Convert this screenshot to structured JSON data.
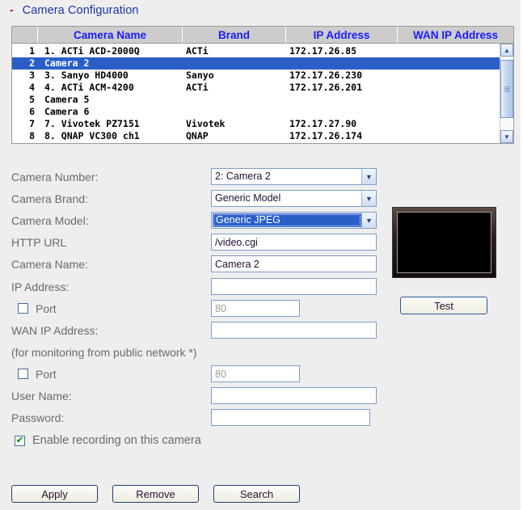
{
  "page": {
    "title": "Camera Configuration",
    "collapse_glyph": "-"
  },
  "camera_table": {
    "columns": [
      "",
      "Camera Name",
      "Brand",
      "IP Address",
      "WAN IP Address"
    ],
    "rows": [
      {
        "num": "1",
        "name": "1. ACTi ACD-2000Q",
        "brand": "ACTi",
        "ip": "172.17.26.85",
        "wan": "",
        "selected": false
      },
      {
        "num": "2",
        "name": "Camera 2",
        "brand": "",
        "ip": "",
        "wan": "",
        "selected": true
      },
      {
        "num": "3",
        "name": "3. Sanyo HD4000",
        "brand": "Sanyo",
        "ip": "172.17.26.230",
        "wan": "",
        "selected": false
      },
      {
        "num": "4",
        "name": "4. ACTi ACM-4200",
        "brand": "ACTi",
        "ip": "172.17.26.201",
        "wan": "",
        "selected": false
      },
      {
        "num": "5",
        "name": "Camera 5",
        "brand": "",
        "ip": "",
        "wan": "",
        "selected": false
      },
      {
        "num": "6",
        "name": "Camera 6",
        "brand": "",
        "ip": "",
        "wan": "",
        "selected": false
      },
      {
        "num": "7",
        "name": "7. Vivotek PZ7151",
        "brand": "Vivotek",
        "ip": "172.17.27.90",
        "wan": "",
        "selected": false
      },
      {
        "num": "8",
        "name": "8. QNAP VC300 ch1",
        "brand": "QNAP",
        "ip": "172.17.26.174",
        "wan": "",
        "selected": false
      }
    ],
    "scroll_up_glyph": "▲",
    "scroll_down_glyph": "▼"
  },
  "form": {
    "camera_number": {
      "label": "Camera Number:",
      "value": "2: Camera 2"
    },
    "camera_brand": {
      "label": "Camera Brand:",
      "value": "Generic Model"
    },
    "camera_model": {
      "label": "Camera Model:",
      "value": "Generic JPEG"
    },
    "http_url": {
      "label": "HTTP URL",
      "value": "/video.cgi"
    },
    "camera_name": {
      "label": "Camera Name:",
      "value": "Camera 2"
    },
    "ip_address": {
      "label": "IP Address:",
      "value": ""
    },
    "lan_port": {
      "label": "Port",
      "value": "80",
      "checked": false
    },
    "wan_ip": {
      "label": "WAN IP Address:",
      "value": ""
    },
    "wan_note": "(for monitoring from public network *)",
    "wan_port": {
      "label": "Port",
      "value": "80",
      "checked": false
    },
    "user_name": {
      "label": "User Name:",
      "value": ""
    },
    "password": {
      "label": "Password:",
      "value": ""
    },
    "enable_recording": {
      "label": "Enable recording on this camera",
      "checked": true,
      "tick": "✔"
    },
    "dropdown_arrow": "▼"
  },
  "preview": {
    "test_label": "Test"
  },
  "buttons": {
    "apply": "Apply",
    "remove": "Remove",
    "search": "Search"
  },
  "colors": {
    "title_blue": "#1a33aa",
    "minus_red": "#cc0000",
    "header_text_blue": "#1a1aff",
    "selection_blue": "#2a5fc8",
    "label_gray": "#6a6a6a",
    "page_bg": "#eeeeee"
  }
}
